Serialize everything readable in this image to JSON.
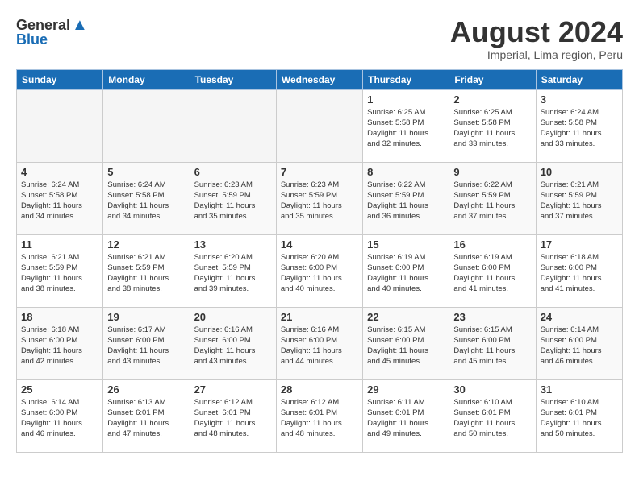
{
  "header": {
    "logo_general": "General",
    "logo_blue": "Blue",
    "month_year": "August 2024",
    "location": "Imperial, Lima region, Peru"
  },
  "weekdays": [
    "Sunday",
    "Monday",
    "Tuesday",
    "Wednesday",
    "Thursday",
    "Friday",
    "Saturday"
  ],
  "weeks": [
    [
      {
        "day": "",
        "info": ""
      },
      {
        "day": "",
        "info": ""
      },
      {
        "day": "",
        "info": ""
      },
      {
        "day": "",
        "info": ""
      },
      {
        "day": "1",
        "info": "Sunrise: 6:25 AM\nSunset: 5:58 PM\nDaylight: 11 hours\nand 32 minutes."
      },
      {
        "day": "2",
        "info": "Sunrise: 6:25 AM\nSunset: 5:58 PM\nDaylight: 11 hours\nand 33 minutes."
      },
      {
        "day": "3",
        "info": "Sunrise: 6:24 AM\nSunset: 5:58 PM\nDaylight: 11 hours\nand 33 minutes."
      }
    ],
    [
      {
        "day": "4",
        "info": "Sunrise: 6:24 AM\nSunset: 5:58 PM\nDaylight: 11 hours\nand 34 minutes."
      },
      {
        "day": "5",
        "info": "Sunrise: 6:24 AM\nSunset: 5:58 PM\nDaylight: 11 hours\nand 34 minutes."
      },
      {
        "day": "6",
        "info": "Sunrise: 6:23 AM\nSunset: 5:59 PM\nDaylight: 11 hours\nand 35 minutes."
      },
      {
        "day": "7",
        "info": "Sunrise: 6:23 AM\nSunset: 5:59 PM\nDaylight: 11 hours\nand 35 minutes."
      },
      {
        "day": "8",
        "info": "Sunrise: 6:22 AM\nSunset: 5:59 PM\nDaylight: 11 hours\nand 36 minutes."
      },
      {
        "day": "9",
        "info": "Sunrise: 6:22 AM\nSunset: 5:59 PM\nDaylight: 11 hours\nand 37 minutes."
      },
      {
        "day": "10",
        "info": "Sunrise: 6:21 AM\nSunset: 5:59 PM\nDaylight: 11 hours\nand 37 minutes."
      }
    ],
    [
      {
        "day": "11",
        "info": "Sunrise: 6:21 AM\nSunset: 5:59 PM\nDaylight: 11 hours\nand 38 minutes."
      },
      {
        "day": "12",
        "info": "Sunrise: 6:21 AM\nSunset: 5:59 PM\nDaylight: 11 hours\nand 38 minutes."
      },
      {
        "day": "13",
        "info": "Sunrise: 6:20 AM\nSunset: 5:59 PM\nDaylight: 11 hours\nand 39 minutes."
      },
      {
        "day": "14",
        "info": "Sunrise: 6:20 AM\nSunset: 6:00 PM\nDaylight: 11 hours\nand 40 minutes."
      },
      {
        "day": "15",
        "info": "Sunrise: 6:19 AM\nSunset: 6:00 PM\nDaylight: 11 hours\nand 40 minutes."
      },
      {
        "day": "16",
        "info": "Sunrise: 6:19 AM\nSunset: 6:00 PM\nDaylight: 11 hours\nand 41 minutes."
      },
      {
        "day": "17",
        "info": "Sunrise: 6:18 AM\nSunset: 6:00 PM\nDaylight: 11 hours\nand 41 minutes."
      }
    ],
    [
      {
        "day": "18",
        "info": "Sunrise: 6:18 AM\nSunset: 6:00 PM\nDaylight: 11 hours\nand 42 minutes."
      },
      {
        "day": "19",
        "info": "Sunrise: 6:17 AM\nSunset: 6:00 PM\nDaylight: 11 hours\nand 43 minutes."
      },
      {
        "day": "20",
        "info": "Sunrise: 6:16 AM\nSunset: 6:00 PM\nDaylight: 11 hours\nand 43 minutes."
      },
      {
        "day": "21",
        "info": "Sunrise: 6:16 AM\nSunset: 6:00 PM\nDaylight: 11 hours\nand 44 minutes."
      },
      {
        "day": "22",
        "info": "Sunrise: 6:15 AM\nSunset: 6:00 PM\nDaylight: 11 hours\nand 45 minutes."
      },
      {
        "day": "23",
        "info": "Sunrise: 6:15 AM\nSunset: 6:00 PM\nDaylight: 11 hours\nand 45 minutes."
      },
      {
        "day": "24",
        "info": "Sunrise: 6:14 AM\nSunset: 6:00 PM\nDaylight: 11 hours\nand 46 minutes."
      }
    ],
    [
      {
        "day": "25",
        "info": "Sunrise: 6:14 AM\nSunset: 6:00 PM\nDaylight: 11 hours\nand 46 minutes."
      },
      {
        "day": "26",
        "info": "Sunrise: 6:13 AM\nSunset: 6:01 PM\nDaylight: 11 hours\nand 47 minutes."
      },
      {
        "day": "27",
        "info": "Sunrise: 6:12 AM\nSunset: 6:01 PM\nDaylight: 11 hours\nand 48 minutes."
      },
      {
        "day": "28",
        "info": "Sunrise: 6:12 AM\nSunset: 6:01 PM\nDaylight: 11 hours\nand 48 minutes."
      },
      {
        "day": "29",
        "info": "Sunrise: 6:11 AM\nSunset: 6:01 PM\nDaylight: 11 hours\nand 49 minutes."
      },
      {
        "day": "30",
        "info": "Sunrise: 6:10 AM\nSunset: 6:01 PM\nDaylight: 11 hours\nand 50 minutes."
      },
      {
        "day": "31",
        "info": "Sunrise: 6:10 AM\nSunset: 6:01 PM\nDaylight: 11 hours\nand 50 minutes."
      }
    ]
  ]
}
